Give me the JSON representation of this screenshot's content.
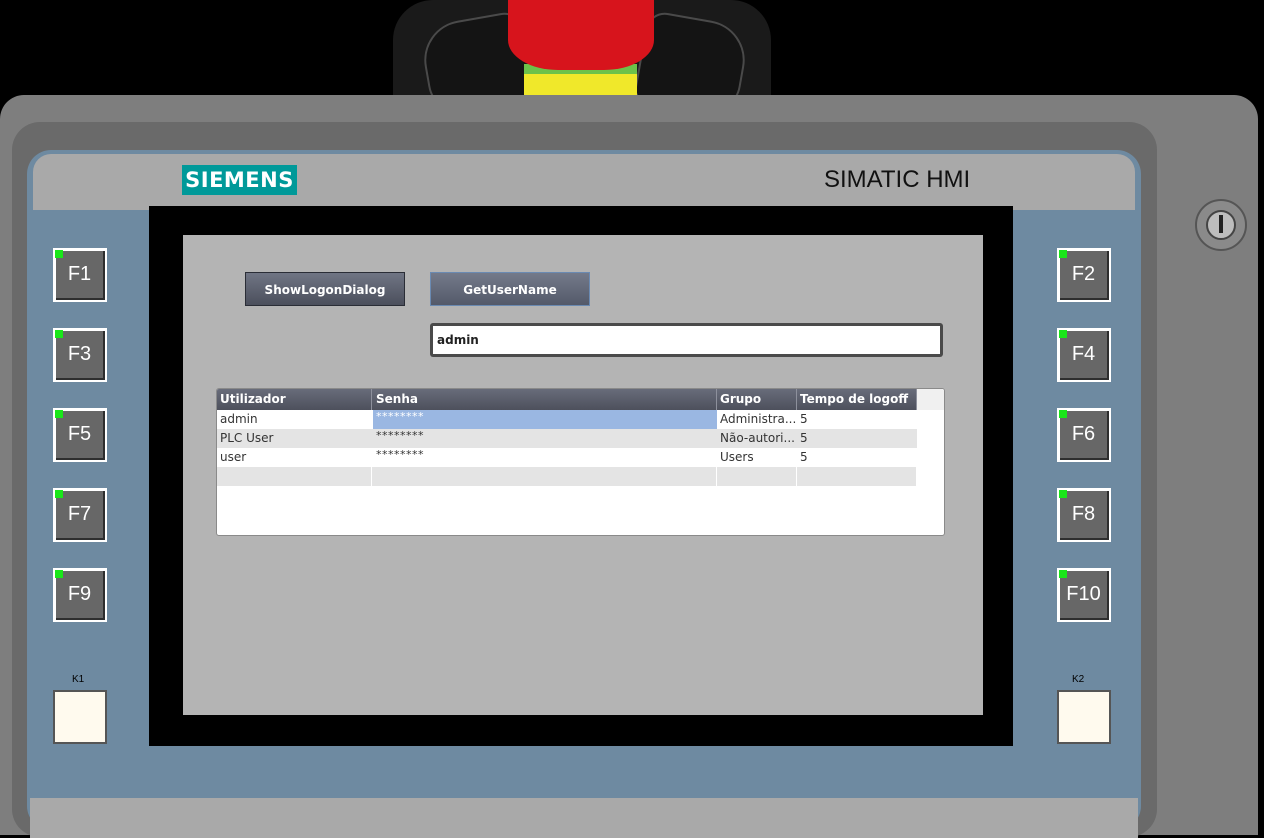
{
  "device": {
    "brand_logo": "SIEMENS",
    "model": "SIMATIC HMI"
  },
  "buttons": {
    "show_logon_dialog": "ShowLogonDialog",
    "get_user_name": "GetUserName"
  },
  "user_name_field": {
    "value": "admin"
  },
  "user_table": {
    "columns": [
      "Utilizador",
      "Senha",
      "Grupo",
      "Tempo de logoff"
    ],
    "rows": [
      {
        "user": "admin",
        "password": "********",
        "group": "Administra...",
        "logoff": "5",
        "selected": true
      },
      {
        "user": "PLC User",
        "password": "********",
        "group": "Não-autori...",
        "logoff": "5",
        "selected": false
      },
      {
        "user": "user",
        "password": "********",
        "group": "Users",
        "logoff": "5",
        "selected": false
      },
      {
        "user": "",
        "password": "",
        "group": "",
        "logoff": "",
        "selected": false
      }
    ]
  },
  "function_keys": {
    "left": [
      "F1",
      "F3",
      "F5",
      "F7",
      "F9"
    ],
    "right": [
      "F2",
      "F4",
      "F6",
      "F8",
      "F10"
    ],
    "k_left": "K1",
    "k_right": "K2"
  },
  "colors": {
    "led": "#19e619",
    "siemens_teal": "#009999",
    "estop_red": "#d7141c",
    "estop_yellow": "#f0e82a",
    "selection": "#9ab7e2"
  },
  "icons": {
    "key_switch": "key-switch-icon",
    "emergency_stop": "emergency-stop-button"
  }
}
